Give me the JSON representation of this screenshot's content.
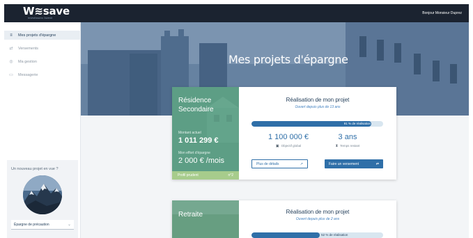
{
  "brand": {
    "logo": "W≋save",
    "tagline": "Investissons l'avenir"
  },
  "header": {
    "greeting": "Bonjour Monsieur Duprez"
  },
  "sidebar": {
    "items": [
      {
        "label": "Mes projets d'épargne",
        "icon": "savings-icon",
        "active": true
      },
      {
        "label": "Versements",
        "icon": "transfer-icon",
        "active": false
      },
      {
        "label": "Ma gestion",
        "icon": "management-icon",
        "active": false
      },
      {
        "label": "Messagerie",
        "icon": "message-icon",
        "active": false
      }
    ]
  },
  "promo": {
    "title": "Un nouveau projet en vue ?",
    "select_value": "Épargne de précaution"
  },
  "hero": {
    "title": "Mes projets d'épargne"
  },
  "projects": [
    {
      "name": "Résidence Secondaire",
      "current_label": "Montant actuel",
      "current_value": "1 011 299 €",
      "effort_label": "Mon effort d'épargne",
      "effort_value": "2 000 € /mois",
      "profile": "Profil prudent",
      "number": "n°2",
      "right_title": "Réalisation de mon projet",
      "opened": "Ouvert depuis plus de 13 ans",
      "progress_percent": 91,
      "progress_text": "91 % de réalisation",
      "goal_value": "1 100 000 €",
      "goal_label": "Objectif global",
      "time_value": "3 ans",
      "time_label": "Temps restant",
      "details_button": "Plus de détails",
      "deposit_button": "Faire un versement"
    },
    {
      "name": "Retraite",
      "right_title": "Réalisation de mon projet",
      "opened": "Ouvert depuis plus de 2 ans",
      "progress_percent": 52,
      "progress_text": "52 % de réalisation"
    }
  ],
  "colors": {
    "topbar": "#1b2330",
    "accent": "#2f6fa8",
    "card_green": "#5d9e86",
    "footer_green": "#a7cc8c",
    "hero": "#5d7898"
  }
}
